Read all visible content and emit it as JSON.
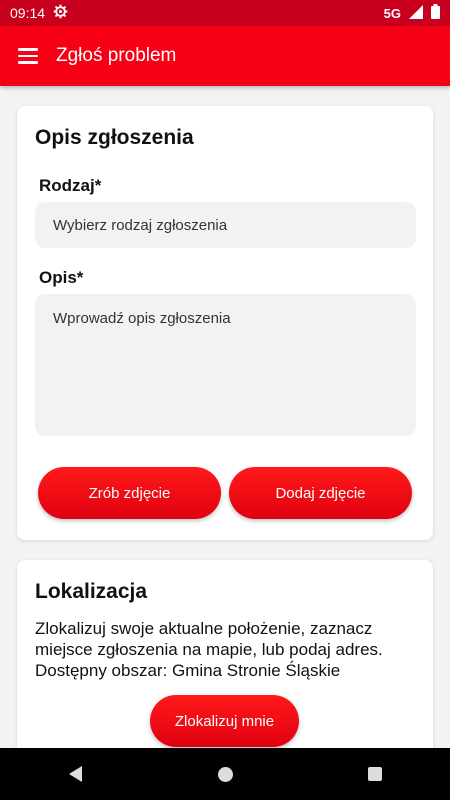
{
  "status_bar": {
    "time": "09:14",
    "network": "5G",
    "icons": [
      "settings-gear-icon",
      "signal-icon",
      "battery-icon"
    ]
  },
  "app_bar": {
    "title": "Zgłoś problem",
    "menu_icon": "hamburger-menu-icon"
  },
  "description_card": {
    "title": "Opis zgłoszenia",
    "type_label": "Rodzaj*",
    "type_placeholder": "Wybierz rodzaj zgłoszenia",
    "description_label": "Opis*",
    "description_placeholder": "Wprowadź opis zgłoszenia",
    "take_photo_label": "Zrób zdjęcie",
    "add_photo_label": "Dodaj zdjęcie"
  },
  "location_card": {
    "title": "Lokalizacja",
    "instructions": "Zlokalizuj swoje aktualne położenie, zaznacz miejsce zgłoszenia na mapie, lub podaj adres. Dostępny obszar: Gmina Stronie Śląskie",
    "locate_label": "Zlokalizuj mnie"
  },
  "colors": {
    "status_bar": "#c8001e",
    "app_bar": "#f50014",
    "button": "#f0000f",
    "field_bg": "#f2f2f2"
  }
}
